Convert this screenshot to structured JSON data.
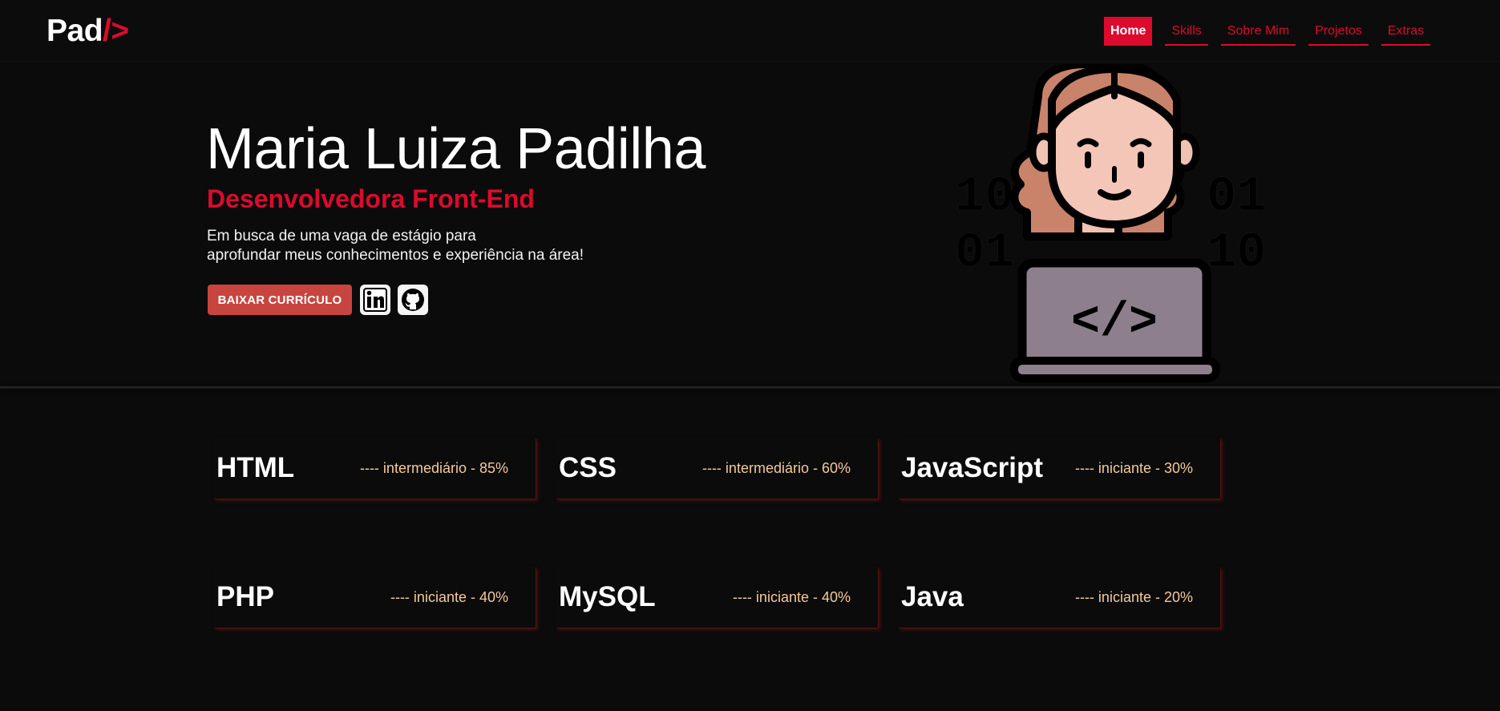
{
  "logo": {
    "text": "Pad",
    "accent": "/>"
  },
  "nav": [
    {
      "label": "Home",
      "active": true
    },
    {
      "label": "Skills",
      "active": false
    },
    {
      "label": "Sobre Mim",
      "active": false
    },
    {
      "label": "Projetos",
      "active": false
    },
    {
      "label": "Extras",
      "active": false
    }
  ],
  "hero": {
    "name": "Maria Luiza Padilha",
    "role": "Desenvolvedora Front-End",
    "intro_line1": "Em busca de uma vaga de estágio para",
    "intro_line2": "aprofundar meus conhecimentos e experiência na área!",
    "cv_button": "BAIXAR CURRÍCULO",
    "illustration_code": "</>",
    "binary_left_top": "10",
    "binary_left_bottom": "01",
    "binary_right_top": "01",
    "binary_right_bottom": "10"
  },
  "skills": [
    {
      "name": "HTML",
      "level": "---- intermediário - 85%"
    },
    {
      "name": "CSS",
      "level": "---- intermediário - 60%"
    },
    {
      "name": "JavaScript",
      "level": "---- iniciante - 30%"
    },
    {
      "name": "PHP",
      "level": "---- iniciante - 40%"
    },
    {
      "name": "MySQL",
      "level": "---- iniciante - 40%"
    },
    {
      "name": "Java",
      "level": "---- iniciante - 20%"
    }
  ],
  "colors": {
    "accent": "#dc0a2d",
    "background": "#0b0b0b",
    "button": "#c8453f",
    "skill_level": "#f3c99b"
  },
  "icons": [
    "linkedin-icon",
    "github-icon",
    "developer-avatar-icon"
  ]
}
